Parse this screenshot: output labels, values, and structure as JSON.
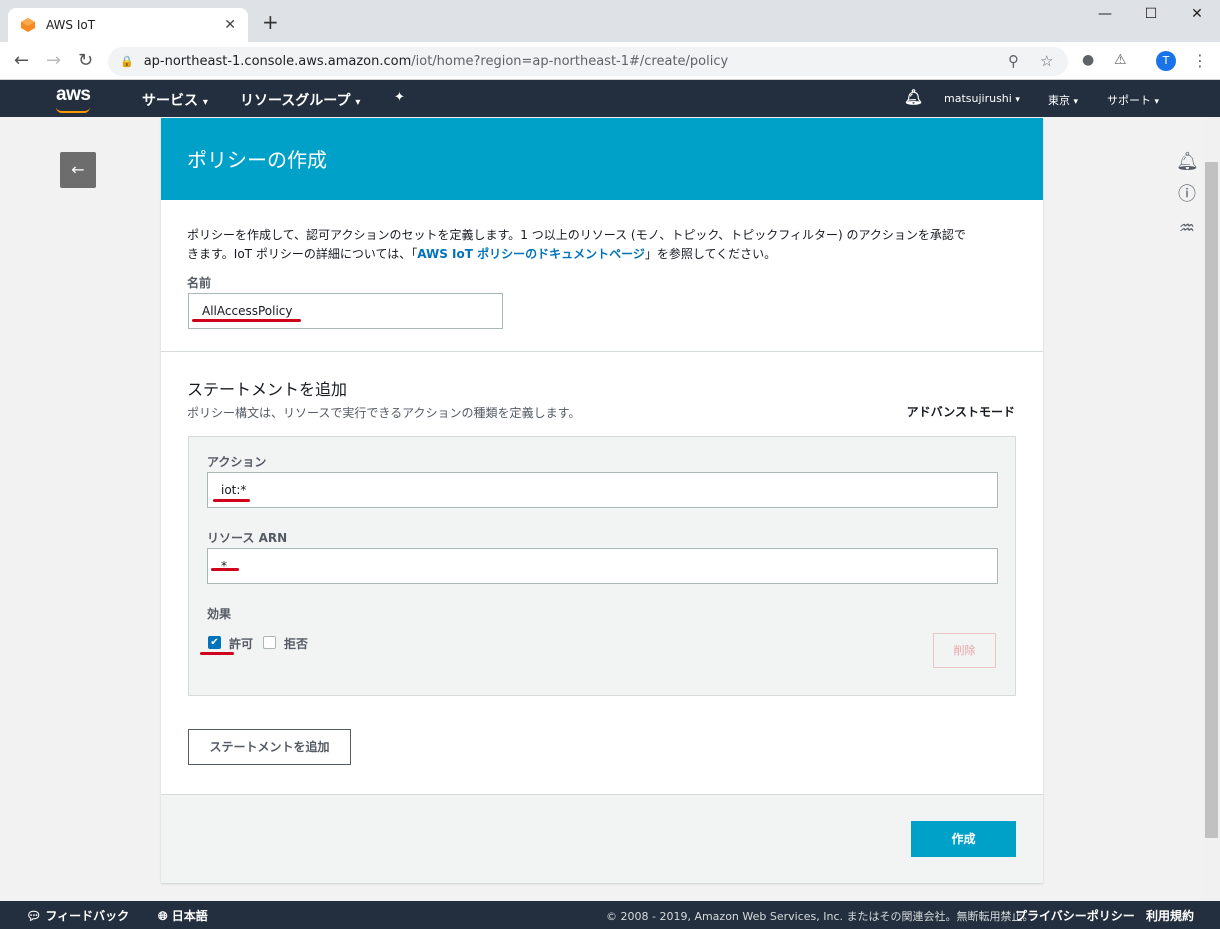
{
  "browser": {
    "tab_title": "AWS IoT",
    "tab_close": "✕",
    "new_tab": "+",
    "url_host": "ap-northeast-1.console.aws.amazon.com",
    "url_path": "/iot/home?region=ap-northeast-1#/create/policy",
    "avatar_initial": "T"
  },
  "aws_header": {
    "logo": "aws",
    "services": "サービス",
    "resource_groups": "リソースグループ",
    "account": "matsujirushi",
    "region": "東京",
    "support": "サポート"
  },
  "card": {
    "title": "ポリシーの作成",
    "description_1": "ポリシーを作成して、認可アクションのセットを定義します。1 つ以上のリソース (モノ、トピック、トピックフィルター) のアクションを承認で",
    "description_2_prefix": "きます。IoT ポリシーの詳細については、「",
    "description_link": "AWS IoT ポリシーのドキュメントページ",
    "description_2_suffix": "」を参照してください。",
    "name_label": "名前",
    "name_value": "AllAccessPolicy",
    "section_title": "ステートメントを追加",
    "section_sub": "ポリシー構文は、リソースで実行できるアクションの種類を定義します。",
    "advanced_mode": "アドバンストモード",
    "statement": {
      "action_label": "アクション",
      "action_value": "iot:*",
      "resource_label": "リソース ARN",
      "resource_value": "*",
      "effect_label": "効果",
      "allow_label": "許可",
      "deny_label": "拒否",
      "allow_checked": true,
      "deny_checked": false,
      "delete_label": "削除"
    },
    "add_statement_label": "ステートメントを追加",
    "create_label": "作成"
  },
  "bottom": {
    "feedback": "フィードバック",
    "language": "日本語",
    "copyright": "© 2008 - 2019, Amazon Web Services, Inc. またはその関連会社。無断転用禁止。",
    "privacy": "プライバシーポリシー",
    "terms": "利用規約"
  },
  "colors": {
    "header_bg": "#00a1c9",
    "nav_bg": "#232f3e",
    "primary_button": "#00a1c9",
    "link": "#0073bb",
    "annotation": "#d0021b"
  }
}
